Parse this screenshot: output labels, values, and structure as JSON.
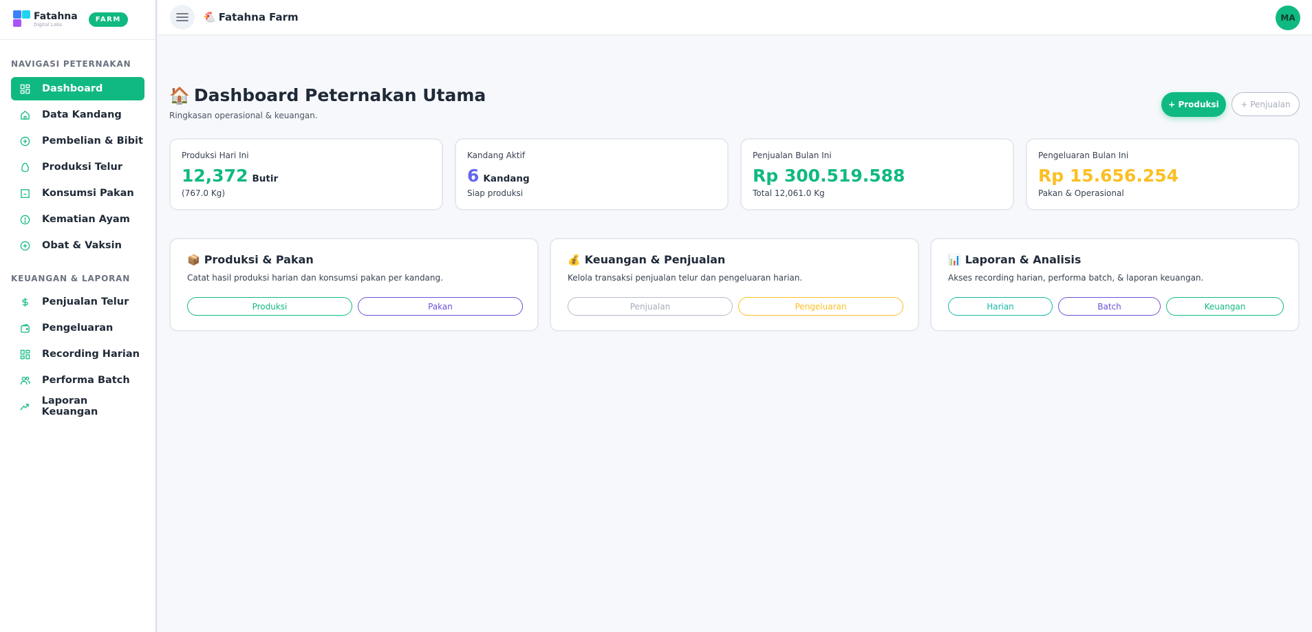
{
  "brand": {
    "name": "Fatahna",
    "sub": "Digital Labs",
    "badge": "FARM"
  },
  "sidebar": {
    "section1": "NAVIGASI PETERNAKAN",
    "items1": [
      {
        "label": "Dashboard",
        "icon": "grid-icon"
      },
      {
        "label": "Data Kandang",
        "icon": "home-icon"
      },
      {
        "label": "Pembelian & Bibit",
        "icon": "plus-circle-icon"
      },
      {
        "label": "Produksi Telur",
        "icon": "egg-icon"
      },
      {
        "label": "Konsumsi Pakan",
        "icon": "box-icon"
      },
      {
        "label": "Kematian Ayam",
        "icon": "alert-circle-icon"
      },
      {
        "label": "Obat & Vaksin",
        "icon": "plus-circle-icon"
      }
    ],
    "section2": "KEUANGAN & LAPORAN",
    "items2": [
      {
        "label": "Penjualan Telur",
        "icon": "dollar-icon"
      },
      {
        "label": "Pengeluaran",
        "icon": "wallet-icon"
      },
      {
        "label": "Recording Harian",
        "icon": "grid-icon"
      },
      {
        "label": "Performa Batch",
        "icon": "users-icon"
      },
      {
        "label": "Laporan Keuangan",
        "icon": "trend-icon"
      }
    ]
  },
  "topbar": {
    "logo_emoji": "🐔",
    "title": "Fatahna Farm",
    "avatar": "MA"
  },
  "page": {
    "title_emoji": "🏠",
    "title": "Dashboard Peternakan Utama",
    "subtitle": "Ringkasan operasional & keuangan.",
    "btn_produksi": "+ Produksi",
    "btn_penjualan": "+ Penjualan"
  },
  "stats": [
    {
      "label": "Produksi Hari Ini",
      "value": "12,372",
      "unit": "Butir",
      "note": "(767.0 Kg)",
      "color": "#10b981"
    },
    {
      "label": "Kandang Aktif",
      "value": "6",
      "unit": "Kandang",
      "note": "Siap produksi",
      "color": "#6366f1"
    },
    {
      "label": "Penjualan Bulan Ini",
      "value": "Rp 300.519.588",
      "unit": "",
      "note": "Total 12,061.0 Kg",
      "color": "#10b981"
    },
    {
      "label": "Pengeluaran Bulan Ini",
      "value": "Rp 15.656.254",
      "unit": "",
      "note": "Pakan & Operasional",
      "color": "#fbbf24"
    }
  ],
  "cards": [
    {
      "emoji": "📦",
      "title": "Produksi & Pakan",
      "desc": "Catat hasil produksi harian dan konsumsi pakan per kandang.",
      "buttons": [
        {
          "label": "Produksi",
          "color": "#10b981"
        },
        {
          "label": "Pakan",
          "color": "#6d4fd8"
        }
      ]
    },
    {
      "emoji": "💰",
      "title": "Keuangan & Penjualan",
      "desc": "Kelola transaksi penjualan telur dan pengeluaran harian.",
      "buttons": [
        {
          "label": "Penjualan",
          "color": "#a5adb9"
        },
        {
          "label": "Pengeluaran",
          "color": "#fbbf24"
        }
      ]
    },
    {
      "emoji": "📊",
      "title": "Laporan & Analisis",
      "desc": "Akses recording harian, performa batch, & laporan keuangan.",
      "buttons": [
        {
          "label": "Harian",
          "color": "#14b8a6"
        },
        {
          "label": "Batch",
          "color": "#6d4fd8"
        },
        {
          "label": "Keuangan",
          "color": "#10b981"
        }
      ]
    }
  ]
}
